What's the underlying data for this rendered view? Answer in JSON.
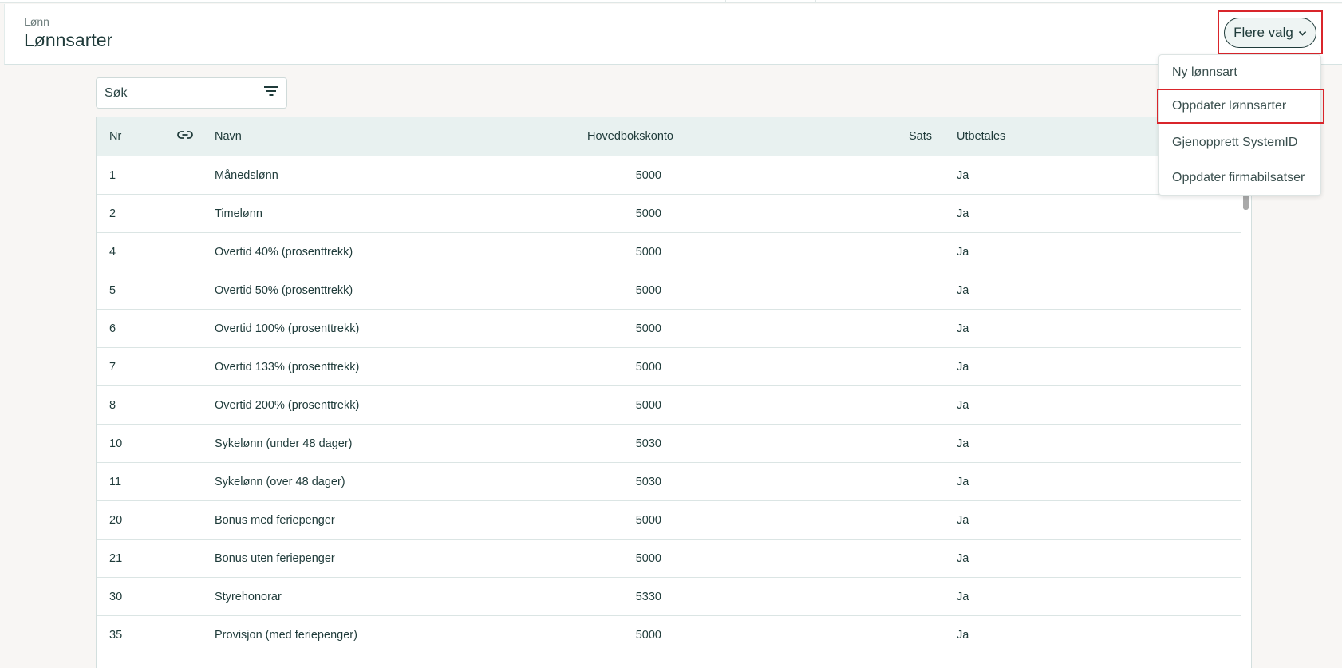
{
  "header": {
    "breadcrumb": "Lønn",
    "title": "Lønnsarter",
    "more_button": "Flere valg"
  },
  "search": {
    "placeholder": "Søk"
  },
  "menu": {
    "items": [
      {
        "label": "Ny lønnsart"
      },
      {
        "label": "Oppdater lønnsarter"
      },
      {
        "label": "Gjenopprett SystemID"
      },
      {
        "label": "Oppdater firmabilsatser"
      }
    ]
  },
  "table": {
    "columns": {
      "nr": "Nr",
      "navn": "Navn",
      "konto": "Hovedbokskonto",
      "sats": "Sats",
      "utbetales": "Utbetales"
    },
    "rows": [
      {
        "nr": "1",
        "navn": "Månedslønn",
        "konto": "5000",
        "sats": "",
        "utbetales": "Ja"
      },
      {
        "nr": "2",
        "navn": "Timelønn",
        "konto": "5000",
        "sats": "",
        "utbetales": "Ja"
      },
      {
        "nr": "4",
        "navn": "Overtid 40% (prosenttrekk)",
        "konto": "5000",
        "sats": "",
        "utbetales": "Ja"
      },
      {
        "nr": "5",
        "navn": "Overtid 50% (prosenttrekk)",
        "konto": "5000",
        "sats": "",
        "utbetales": "Ja"
      },
      {
        "nr": "6",
        "navn": "Overtid 100% (prosenttrekk)",
        "konto": "5000",
        "sats": "",
        "utbetales": "Ja"
      },
      {
        "nr": "7",
        "navn": "Overtid 133% (prosenttrekk)",
        "konto": "5000",
        "sats": "",
        "utbetales": "Ja"
      },
      {
        "nr": "8",
        "navn": "Overtid 200% (prosenttrekk)",
        "konto": "5000",
        "sats": "",
        "utbetales": "Ja"
      },
      {
        "nr": "10",
        "navn": "Sykelønn (under 48 dager)",
        "konto": "5030",
        "sats": "",
        "utbetales": "Ja"
      },
      {
        "nr": "11",
        "navn": "Sykelønn (over 48 dager)",
        "konto": "5030",
        "sats": "",
        "utbetales": "Ja"
      },
      {
        "nr": "20",
        "navn": "Bonus med feriepenger",
        "konto": "5000",
        "sats": "",
        "utbetales": "Ja"
      },
      {
        "nr": "21",
        "navn": "Bonus uten feriepenger",
        "konto": "5000",
        "sats": "",
        "utbetales": "Ja"
      },
      {
        "nr": "30",
        "navn": "Styrehonorar",
        "konto": "5330",
        "sats": "",
        "utbetales": "Ja"
      },
      {
        "nr": "35",
        "navn": "Provisjon (med feriepenger)",
        "konto": "5000",
        "sats": "",
        "utbetales": "Ja"
      }
    ]
  },
  "icons": {
    "link": "link-icon",
    "filter": "filter-icon",
    "chevron": "chevron-down-icon"
  },
  "colors": {
    "accent": "#1f3b3a",
    "header_bg": "#e8f1f0",
    "highlight_border": "#d9252b"
  }
}
